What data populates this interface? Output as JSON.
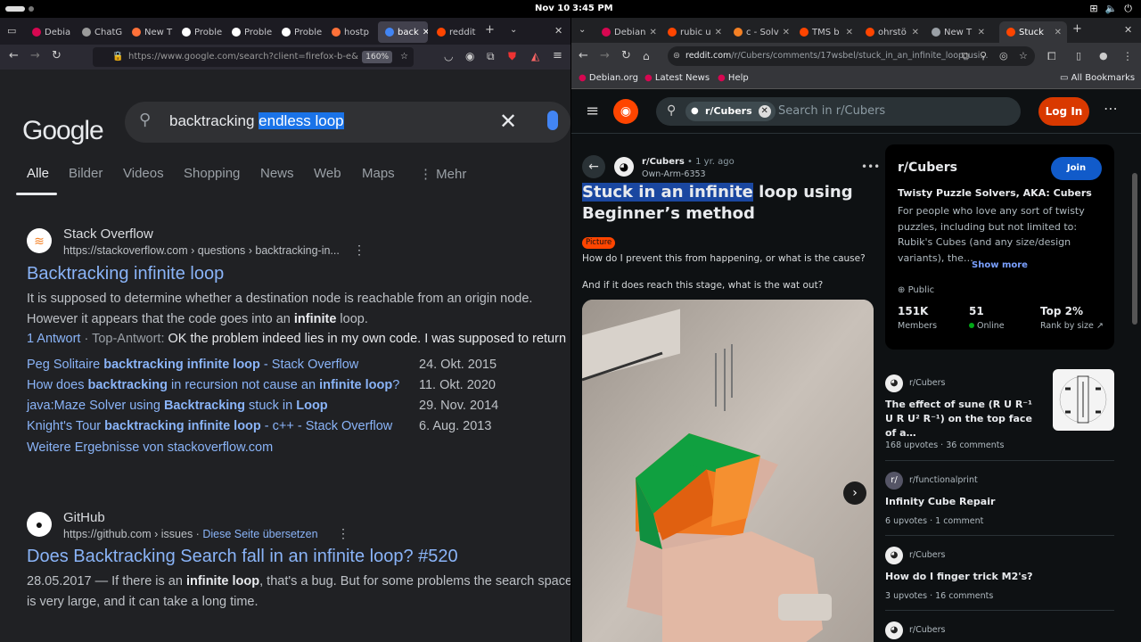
{
  "topbar": {
    "date": "Nov 10",
    "time": "3:45 PM",
    "network_icon": "network-icon",
    "volume_icon": "volume-icon",
    "power_icon": "power-icon"
  },
  "left": {
    "tabs": [
      {
        "label": "Debia",
        "color": "#d70751"
      },
      {
        "label": "ChatG",
        "color": "#9b9b9b"
      },
      {
        "label": "New T",
        "color": "#ff7139"
      },
      {
        "label": "Proble",
        "color": "#ffffff"
      },
      {
        "label": "Proble",
        "color": "#ffffff"
      },
      {
        "label": "Proble",
        "color": "#ffffff"
      },
      {
        "label": "hostp",
        "color": "#ff7139"
      },
      {
        "label": "back",
        "color": "#4285f4"
      },
      {
        "label": "reddit",
        "color": "#ff4500"
      }
    ],
    "url": "https://www.google.com/search?client=firefox-b-e&",
    "zoom": "160%",
    "google": {
      "logo": "Google",
      "query_plain": "backtracking ",
      "query_selected": "endless loop",
      "tabs": [
        "Alle",
        "Bilder",
        "Videos",
        "Shopping",
        "News",
        "Web",
        "Maps",
        "Mehr"
      ],
      "result1": {
        "site": "Stack Overflow",
        "url": "https://stackoverflow.com › questions › backtracking-in...",
        "title": "Backtracking infinite loop",
        "snippet_line1": "It is supposed to determine whether a destination node is reachable from an origin node.",
        "snippet_line2_pre": "However it appears that the code goes into an ",
        "snippet_line2_bold": "infinite",
        "snippet_line2_post": " loop.",
        "answers": "1 Antwort",
        "top_label": " · Top-Antwort: ",
        "top_answer": "OK the problem indeed lies in my own code. I was supposed to return",
        "subresults": [
          {
            "pre": "Peg Solitaire ",
            "bold": "backtracking infinite loop",
            "post": " - Stack Overflow",
            "date": "24. Okt. 2015"
          },
          {
            "pre": "How does ",
            "bold": "backtracking",
            "post": " in recursion not cause an ",
            "bold2": "infinite loop",
            "post2": "?",
            "date": "11. Okt. 2020"
          },
          {
            "pre": "java:Maze Solver using ",
            "bold": "Backtracking",
            "post": " stuck in ",
            "bold2": "Loop",
            "post2": "",
            "date": "29. Nov. 2014"
          },
          {
            "pre": "Knight's Tour ",
            "bold": "backtracking infinite loop",
            "post": " - c++ - Stack Overflow",
            "date": "6. Aug. 2013"
          }
        ],
        "more": "Weitere Ergebnisse von stackoverflow.com"
      },
      "result2": {
        "site": "GitHub",
        "url": "https://github.com › issues",
        "translate": "Diese Seite übersetzen",
        "title": "Does Backtracking Search fall in an infinite loop? #520",
        "snippet_line1_pre": "28.05.2017 — If there is an ",
        "snippet_line1_bold": "infinite loop",
        "snippet_line1_post": ", that's a bug. But for some problems the search space",
        "snippet_line2": "is very large, and it can take a long time."
      }
    }
  },
  "right": {
    "tabs": [
      {
        "label": "Debian",
        "color": "#d70751"
      },
      {
        "label": "rubic u",
        "color": "#ff4500"
      },
      {
        "label": "c - Solv",
        "color": "#f48024"
      },
      {
        "label": "TMS b",
        "color": "#ff4500"
      },
      {
        "label": "ohrstö",
        "color": "#ff4500"
      },
      {
        "label": "New T",
        "color": "#9aa0a6"
      },
      {
        "label": "Stuck",
        "color": "#ff4500"
      }
    ],
    "url_host": "reddit.com",
    "url_path": "/r/Cubers/comments/17wsbel/stuck_in_an_infinite_loop_usi...",
    "bookmarks": [
      "Debian.org",
      "Latest News",
      "Help",
      "All Bookmarks"
    ],
    "reddit": {
      "chip": "r/Cubers",
      "search_placeholder": "Search in r/Cubers",
      "login": "Log In",
      "post": {
        "subreddit": "r/Cubers",
        "age": " • 1 yr. ago",
        "user": "Own-Arm-6353",
        "title_selected": "Stuck in an infinite",
        "title_rest": " loop using Beginner’s method",
        "flair": "Picture",
        "text1": "How do I prevent this from happening, or what is the cause?",
        "text2": "And if it does reach this stage, what is the wat out?"
      },
      "sidebar": {
        "name": "r/Cubers",
        "join": "Join",
        "tagline": "Twisty Puzzle Solvers, AKA: Cubers",
        "desc": "For people who love any sort of twisty puzzles, including but not limited to: Rubik's Cubes (and any size/design variants), the…",
        "show_more": "Show more",
        "visibility": "Public",
        "stats": [
          {
            "value": "151K",
            "label": "Members"
          },
          {
            "value": "51",
            "label": "Online"
          },
          {
            "value": "Top 2%",
            "label": "Rank by size"
          }
        ]
      },
      "related": [
        {
          "sub": "r/Cubers",
          "title": "The effect of sune (R U R⁻¹ U R U² R⁻¹) on the top face of a…",
          "meta": "168 upvotes · 36 comments"
        },
        {
          "sub": "r/functionalprint",
          "title": "Infinity Cube Repair",
          "meta": "6 upvotes · 1 comment"
        },
        {
          "sub": "r/Cubers",
          "title": "How do I finger trick M2's?",
          "meta": "3 upvotes · 16 comments"
        },
        {
          "sub": "r/Cubers",
          "title": "",
          "meta": ""
        }
      ]
    }
  }
}
